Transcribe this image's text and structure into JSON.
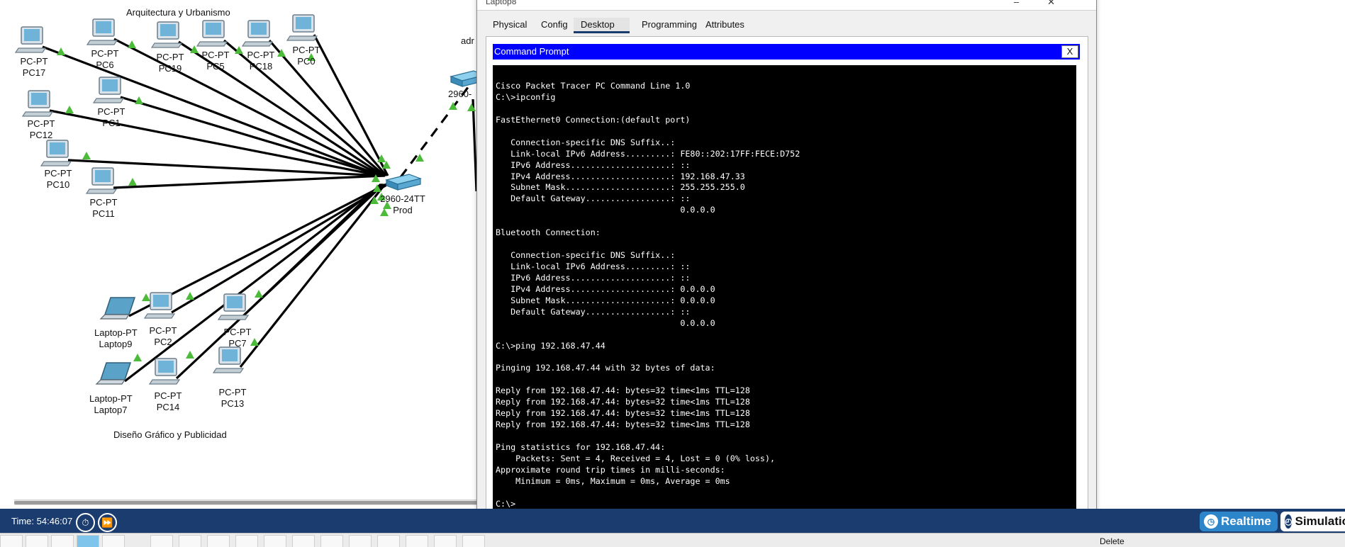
{
  "window": {
    "title": "Laptop8",
    "tabs": [
      {
        "label": "Physical"
      },
      {
        "label": "Config"
      },
      {
        "label": "Desktop"
      },
      {
        "label": "Programming"
      },
      {
        "label": "Attributes"
      }
    ],
    "active_tab": "Desktop"
  },
  "command_prompt": {
    "title": "Command Prompt",
    "close_label": "X",
    "lines": [
      "Cisco Packet Tracer PC Command Line 1.0",
      "C:\\>ipconfig",
      "",
      "FastEthernet0 Connection:(default port)",
      "",
      "   Connection-specific DNS Suffix..:",
      "   Link-local IPv6 Address.........: FE80::202:17FF:FECE:D752",
      "   IPv6 Address....................: ::",
      "   IPv4 Address....................: 192.168.47.33",
      "   Subnet Mask.....................: 255.255.255.0",
      "   Default Gateway.................: ::",
      "                                     0.0.0.0",
      "",
      "Bluetooth Connection:",
      "",
      "   Connection-specific DNS Suffix..:",
      "   Link-local IPv6 Address.........: ::",
      "   IPv6 Address....................: ::",
      "   IPv4 Address....................: 0.0.0.0",
      "   Subnet Mask.....................: 0.0.0.0",
      "   Default Gateway.................: ::",
      "                                     0.0.0.0",
      "",
      "C:\\>ping 192.168.47.44",
      "",
      "Pinging 192.168.47.44 with 32 bytes of data:",
      "",
      "Reply from 192.168.47.44: bytes=32 time<1ms TTL=128",
      "Reply from 192.168.47.44: bytes=32 time<1ms TTL=128",
      "Reply from 192.168.47.44: bytes=32 time<1ms TTL=128",
      "Reply from 192.168.47.44: bytes=32 time<1ms TTL=128",
      "",
      "Ping statistics for 192.168.47.44:",
      "    Packets: Sent = 4, Received = 4, Lost = 0 (0% loss),",
      "Approximate round trip times in milli-seconds:",
      "    Minimum = 0ms, Maximum = 0ms, Average = 0ms",
      "",
      "C:\\>"
    ]
  },
  "topology": {
    "area_labels": {
      "top": "Arquitectura y Urbanismo",
      "bottom": "Diseño Gráfico y Publicidad"
    },
    "partial_label": "adr",
    "switch_right_partial": "2960-",
    "switch": {
      "model": "2960-24TT",
      "name": "Prod"
    },
    "devices": [
      {
        "type": "PC-PT",
        "name": "PC17"
      },
      {
        "type": "PC-PT",
        "name": "PC6"
      },
      {
        "type": "PC-PT",
        "name": "PC19"
      },
      {
        "type": "PC-PT",
        "name": "PC5"
      },
      {
        "type": "PC-PT",
        "name": "PC18"
      },
      {
        "type": "PC-PT",
        "name": "PC0"
      },
      {
        "type": "PC-PT",
        "name": "PC12"
      },
      {
        "type": "PC-PT",
        "name": "PC1"
      },
      {
        "type": "PC-PT",
        "name": "PC10"
      },
      {
        "type": "PC-PT",
        "name": "PC11"
      },
      {
        "type": "Laptop-PT",
        "name": "Laptop9"
      },
      {
        "type": "PC-PT",
        "name": "PC2"
      },
      {
        "type": "PC-PT",
        "name": "PC7"
      },
      {
        "type": "Laptop-PT",
        "name": "Laptop7"
      },
      {
        "type": "PC-PT",
        "name": "PC14"
      },
      {
        "type": "PC-PT",
        "name": "PC13"
      }
    ]
  },
  "status_bar": {
    "time": "Time: 54:46:07",
    "realtime_label": "Realtime",
    "simulation_label": "Simulation",
    "delete_label": "Delete"
  },
  "colors": {
    "cmd_titlebar": "#0000ff",
    "console_bg": "#000000",
    "status_bar": "#1a3c6e",
    "realtime_accent": "#2d86c9",
    "link_led": "#4cbb3a"
  },
  "icons": {
    "pc": "desktop-pc-icon",
    "laptop": "laptop-icon",
    "switch": "network-switch-icon",
    "timer": "timer-icon",
    "fast_forward": "fast-forward-icon"
  }
}
